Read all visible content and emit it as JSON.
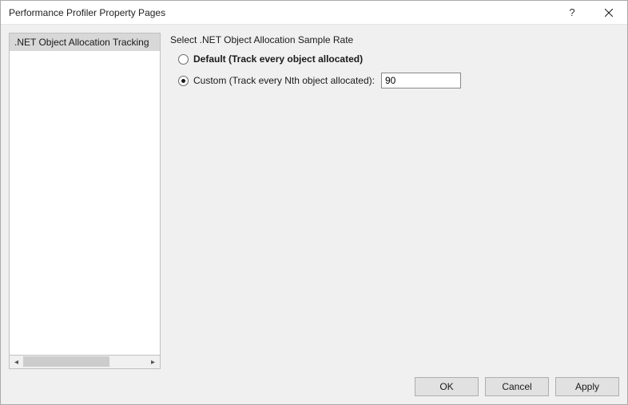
{
  "window": {
    "title": "Performance Profiler Property Pages"
  },
  "sidebar": {
    "items": [
      {
        "label": ".NET Object Allocation Tracking",
        "selected": true
      }
    ]
  },
  "main": {
    "heading": "Select .NET Object Allocation Sample Rate",
    "options": {
      "default": {
        "label": "Default (Track every object allocated)",
        "selected": false
      },
      "custom": {
        "label": "Custom (Track every Nth object allocated):",
        "selected": true,
        "value": "90"
      }
    }
  },
  "footer": {
    "ok": "OK",
    "cancel": "Cancel",
    "apply": "Apply"
  }
}
